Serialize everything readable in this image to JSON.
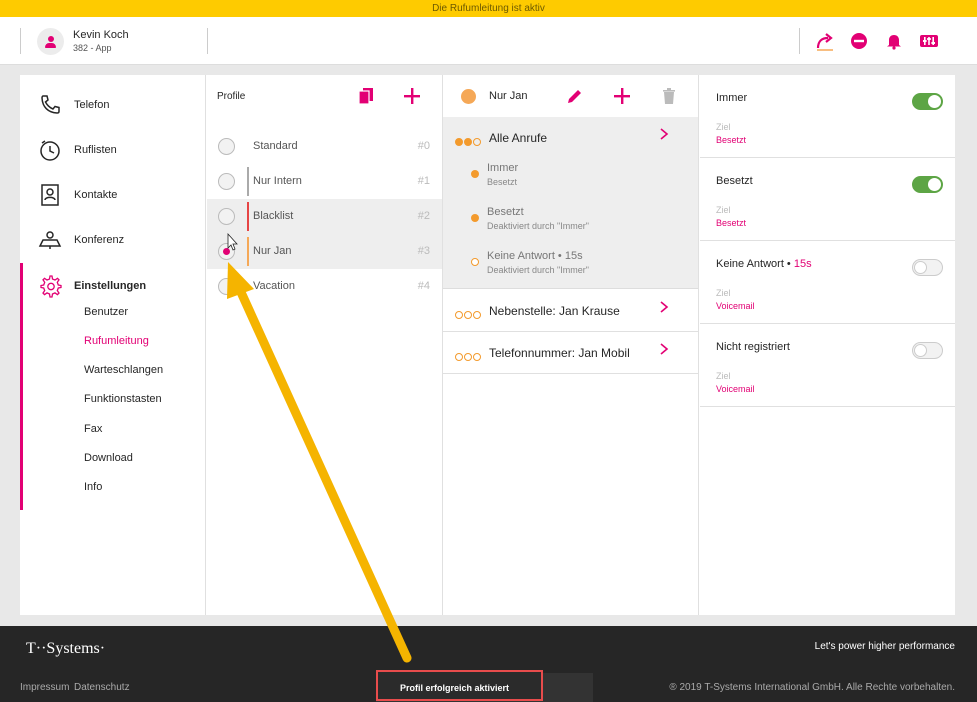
{
  "banner": {
    "text": "Die Rufumleitung ist aktiv"
  },
  "header": {
    "user_name": "Kevin Koch",
    "user_sub": "382 - App",
    "icons": [
      "call-forward-icon",
      "do-not-disturb-icon",
      "bell-icon",
      "mixer-icon"
    ]
  },
  "sidebar": {
    "items": [
      {
        "label": "Telefon",
        "icon": "phone-icon"
      },
      {
        "label": "Ruflisten",
        "icon": "clock-icon"
      },
      {
        "label": "Kontakte",
        "icon": "contacts-icon"
      },
      {
        "label": "Konferenz",
        "icon": "conference-icon"
      },
      {
        "label": "Einstellungen",
        "icon": "gear-icon"
      }
    ],
    "subitems": [
      "Benutzer",
      "Rufumleitung",
      "Warteschlangen",
      "Funktionstasten",
      "Fax",
      "Download",
      "Info"
    ],
    "selected_sub": "Rufumleitung"
  },
  "profiles": {
    "title": "Profile",
    "rows": [
      {
        "name": "Standard",
        "num": "#0",
        "bar": ""
      },
      {
        "name": "Nur Intern",
        "num": "#1",
        "bar": "#aaaaaa"
      },
      {
        "name": "Blacklist",
        "num": "#2",
        "bar": "#e64545"
      },
      {
        "name": "Nur Jan",
        "num": "#3",
        "bar": "#f5a857"
      },
      {
        "name": "Vacation",
        "num": "#4",
        "bar": ""
      }
    ]
  },
  "rules": {
    "profile_name": "Nur Jan",
    "groups": [
      {
        "label": "Alle Anrufe"
      },
      {
        "label": "Nebenstelle: Jan Krause"
      },
      {
        "label": "Telefonnummer: Jan Mobil"
      }
    ],
    "subrules": [
      {
        "title": "Immer",
        "sub": "Besetzt"
      },
      {
        "title": "Besetzt",
        "sub": "Deaktiviert durch \"Immer\""
      },
      {
        "title": "Keine Antwort • 15s",
        "sub": "Deaktiviert durch \"Immer\""
      }
    ]
  },
  "settings": {
    "rows": [
      {
        "title": "Immer",
        "accent": "",
        "ziel_label": "Ziel",
        "ziel": "Besetzt",
        "on": true
      },
      {
        "title": "Besetzt",
        "accent": "",
        "ziel_label": "Ziel",
        "ziel": "Besetzt",
        "on": true
      },
      {
        "title": "Keine Antwort •",
        "accent": "15s",
        "ziel_label": "Ziel",
        "ziel": "Voicemail",
        "on": false
      },
      {
        "title": "Nicht registriert",
        "accent": "",
        "ziel_label": "Ziel",
        "ziel": "Voicemail",
        "on": false
      }
    ]
  },
  "footer": {
    "logo": "T··Systems·",
    "slogan": "Let's power higher performance",
    "links": [
      "Impressum",
      "Datenschutz"
    ],
    "copyright": "® 2019 T-Systems International GmbH. Alle Rechte vorbehalten.",
    "toast": "Profil erfolgreich aktiviert"
  },
  "colors": {
    "magenta": "#e20074",
    "orange": "#f39a2c",
    "green": "#5da545",
    "banner": "#fecb00",
    "annotation": "#f5b400"
  }
}
